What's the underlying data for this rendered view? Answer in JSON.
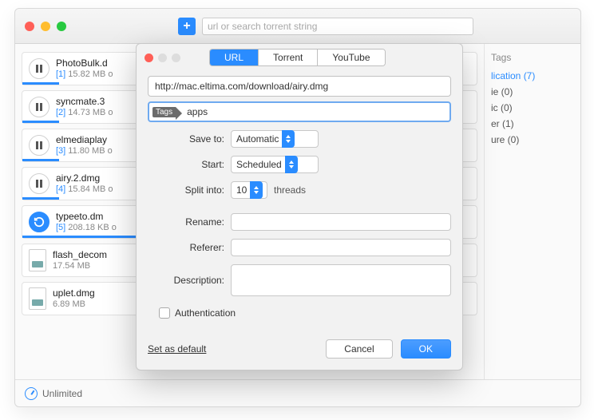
{
  "main": {
    "search_placeholder": "url or search torrent string",
    "footer_status": "Unlimited"
  },
  "downloads": [
    {
      "name": "PhotoBulk.d",
      "index": "[1]",
      "meta": "15.82 MB o",
      "icon": "pause",
      "progress": 8
    },
    {
      "name": "syncmate.3",
      "index": "[2]",
      "meta": "14.73 MB o",
      "icon": "pause",
      "progress": 8
    },
    {
      "name": "elmediaplay",
      "index": "[3]",
      "meta": "11.80 MB o",
      "icon": "pause",
      "progress": 8
    },
    {
      "name": "airy.2.dmg",
      "index": "[4]",
      "meta": "15.84 MB o",
      "icon": "pause",
      "progress": 8
    },
    {
      "name": "typeeto.dm",
      "index": "[5]",
      "meta": "208.18 KB o",
      "icon": "retry",
      "progress": 30
    },
    {
      "name": "flash_decom",
      "index": "",
      "meta": "17.54 MB",
      "icon": "file",
      "progress": 0
    },
    {
      "name": "uplet.dmg",
      "index": "",
      "meta": "6.89 MB",
      "icon": "file",
      "progress": 0
    }
  ],
  "tags_panel": {
    "title": "Tags",
    "items": [
      {
        "label": "lication (7)",
        "active": true
      },
      {
        "label": "ie (0)",
        "active": false
      },
      {
        "label": "ic (0)",
        "active": false
      },
      {
        "label": "er (1)",
        "active": false
      },
      {
        "label": "ure (0)",
        "active": false
      }
    ]
  },
  "dialog": {
    "tabs": [
      "URL",
      "Torrent",
      "YouTube"
    ],
    "active_tab": 0,
    "url_value": "http://mac.eltima.com/download/airy.dmg",
    "tags_badge": "Tags",
    "tags_value": "apps",
    "labels": {
      "save_to": "Save to:",
      "start": "Start:",
      "split_into": "Split into:",
      "threads": "threads",
      "rename": "Rename:",
      "referer": "Referer:",
      "description": "Description:"
    },
    "save_to_value": "Automatic",
    "start_value": "Scheduled",
    "split_value": "10",
    "auth_label": "Authentication",
    "set_default": "Set as default",
    "cancel": "Cancel",
    "ok": "OK"
  }
}
